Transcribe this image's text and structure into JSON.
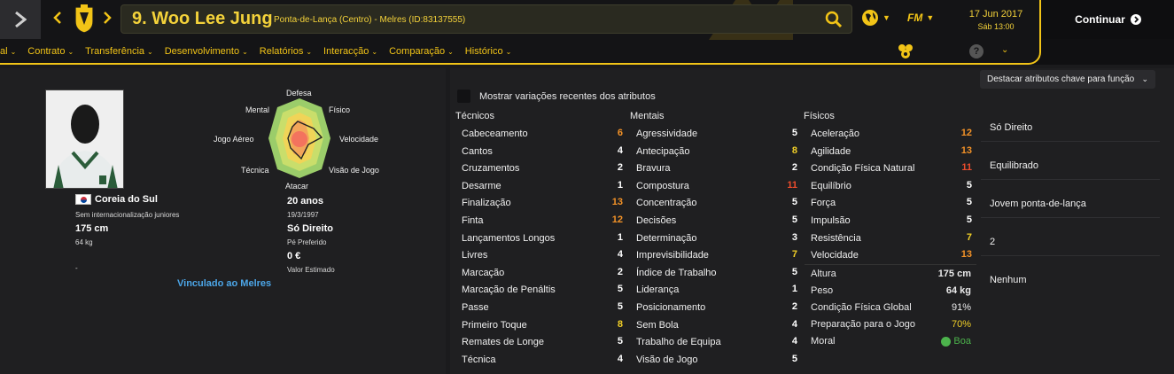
{
  "header": {
    "player_name": "9. Woo Lee Jung",
    "player_sub": "Ponta-de-Lança (Centro) - Melres (ID:83137555)",
    "date_main": "17 Jun 2017",
    "date_sub": "Sáb 13:00",
    "continue_label": "Continuar",
    "fm_logo": "FM"
  },
  "menu": {
    "items": [
      "al",
      "Contrato",
      "Transferência",
      "Desenvolvimento",
      "Relatórios",
      "Interacção",
      "Comparação",
      "Histórico"
    ],
    "help_label": "?"
  },
  "profile": {
    "nation": "Coreia do Sul",
    "youth_caps": "Sem internacionalização juniores",
    "height": "175 cm",
    "weight": "64 kg",
    "dash": "-",
    "age": "20 anos",
    "dob": "19/3/1997",
    "foot": "Só Direito",
    "foot_label": "Pé Preferido",
    "value": "0 €",
    "value_label": "Valor Estimado",
    "contract_link": "Vinculado ao Melres"
  },
  "radar": {
    "labels": {
      "top": "Defesa",
      "upper_left": "Mental",
      "upper_right": "Físico",
      "left": "Jogo Aéreo",
      "right": "Velocidade",
      "lower_left": "Técnica",
      "lower_right": "Visão de Jogo",
      "bottom": "Atacar"
    }
  },
  "attributes": {
    "show_changes_label": "Mostrar variações recentes dos atributos",
    "highlight_dropdown": "Destacar atributos chave para função",
    "technical_title": "Técnicos",
    "mental_title": "Mentais",
    "physical_title": "Físicos",
    "technical": [
      {
        "name": "Cabeceamento",
        "value": "6",
        "color": "#f39227"
      },
      {
        "name": "Cantos",
        "value": "4",
        "color": "#ffffff"
      },
      {
        "name": "Cruzamentos",
        "value": "2",
        "color": "#ffffff"
      },
      {
        "name": "Desarme",
        "value": "1",
        "color": "#ffffff"
      },
      {
        "name": "Finalização",
        "value": "13",
        "color": "#f39227"
      },
      {
        "name": "Finta",
        "value": "12",
        "color": "#f39227"
      },
      {
        "name": "Lançamentos Longos",
        "value": "1",
        "color": "#ffffff"
      },
      {
        "name": "Livres",
        "value": "4",
        "color": "#ffffff"
      },
      {
        "name": "Marcação",
        "value": "2",
        "color": "#ffffff"
      },
      {
        "name": "Marcação de Penáltis",
        "value": "5",
        "color": "#ffffff"
      },
      {
        "name": "Passe",
        "value": "5",
        "color": "#ffffff"
      },
      {
        "name": "Primeiro Toque",
        "value": "8",
        "color": "#f2d027"
      },
      {
        "name": "Remates de Longe",
        "value": "5",
        "color": "#ffffff"
      },
      {
        "name": "Técnica",
        "value": "4",
        "color": "#ffffff"
      }
    ],
    "mental": [
      {
        "name": "Agressividade",
        "value": "5",
        "color": "#ffffff"
      },
      {
        "name": "Antecipação",
        "value": "8",
        "color": "#f2d027"
      },
      {
        "name": "Bravura",
        "value": "2",
        "color": "#ffffff"
      },
      {
        "name": "Compostura",
        "value": "11",
        "color": "#ec4c2c"
      },
      {
        "name": "Concentração",
        "value": "5",
        "color": "#ffffff"
      },
      {
        "name": "Decisões",
        "value": "5",
        "color": "#ffffff"
      },
      {
        "name": "Determinação",
        "value": "3",
        "color": "#ffffff"
      },
      {
        "name": "Imprevisibilidade",
        "value": "7",
        "color": "#f2d027"
      },
      {
        "name": "Índice de Trabalho",
        "value": "5",
        "color": "#ffffff"
      },
      {
        "name": "Liderança",
        "value": "1",
        "color": "#ffffff"
      },
      {
        "name": "Posicionamento",
        "value": "2",
        "color": "#ffffff"
      },
      {
        "name": "Sem Bola",
        "value": "4",
        "color": "#ffffff"
      },
      {
        "name": "Trabalho de Equipa",
        "value": "4",
        "color": "#ffffff"
      },
      {
        "name": "Visão de Jogo",
        "value": "5",
        "color": "#ffffff"
      }
    ],
    "physical": [
      {
        "name": "Aceleração",
        "value": "12",
        "color": "#f39227"
      },
      {
        "name": "Agilidade",
        "value": "13",
        "color": "#f39227"
      },
      {
        "name": "Condição Física Natural",
        "value": "11",
        "color": "#ec4c2c"
      },
      {
        "name": "Equilíbrio",
        "value": "5",
        "color": "#ffffff"
      },
      {
        "name": "Força",
        "value": "5",
        "color": "#ffffff"
      },
      {
        "name": "Impulsão",
        "value": "5",
        "color": "#ffffff"
      },
      {
        "name": "Resistência",
        "value": "7",
        "color": "#f2d027"
      },
      {
        "name": "Velocidade",
        "value": "13",
        "color": "#f39227"
      }
    ]
  },
  "body": {
    "height_label": "Altura",
    "height_value": "175 cm",
    "weight_label": "Peso",
    "weight_value": "64 kg",
    "condition_label": "Condição Física Global",
    "condition_value": "91%",
    "match_prep_label": "Preparação para o Jogo",
    "match_prep_value": "70%",
    "morale_label": "Moral",
    "morale_value": "Boa"
  },
  "side": {
    "values": [
      "Só Direito",
      "Equilibrado",
      "Jovem ponta-de-lança",
      "2",
      "Nenhum"
    ]
  }
}
